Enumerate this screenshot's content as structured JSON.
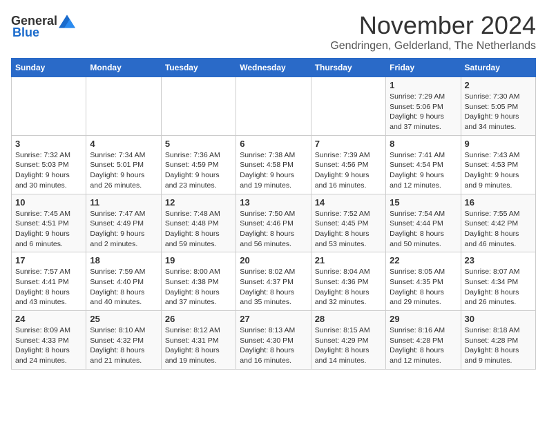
{
  "header": {
    "logo_general": "General",
    "logo_blue": "Blue",
    "title": "November 2024",
    "subtitle": "Gendringen, Gelderland, The Netherlands"
  },
  "days_of_week": [
    "Sunday",
    "Monday",
    "Tuesday",
    "Wednesday",
    "Thursday",
    "Friday",
    "Saturday"
  ],
  "weeks": [
    {
      "row_class": "row-1",
      "days": [
        {
          "number": "",
          "info": ""
        },
        {
          "number": "",
          "info": ""
        },
        {
          "number": "",
          "info": ""
        },
        {
          "number": "",
          "info": ""
        },
        {
          "number": "",
          "info": ""
        },
        {
          "number": "1",
          "info": "Sunrise: 7:29 AM\nSunset: 5:06 PM\nDaylight: 9 hours and 37 minutes."
        },
        {
          "number": "2",
          "info": "Sunrise: 7:30 AM\nSunset: 5:05 PM\nDaylight: 9 hours and 34 minutes."
        }
      ]
    },
    {
      "row_class": "row-2",
      "days": [
        {
          "number": "3",
          "info": "Sunrise: 7:32 AM\nSunset: 5:03 PM\nDaylight: 9 hours and 30 minutes."
        },
        {
          "number": "4",
          "info": "Sunrise: 7:34 AM\nSunset: 5:01 PM\nDaylight: 9 hours and 26 minutes."
        },
        {
          "number": "5",
          "info": "Sunrise: 7:36 AM\nSunset: 4:59 PM\nDaylight: 9 hours and 23 minutes."
        },
        {
          "number": "6",
          "info": "Sunrise: 7:38 AM\nSunset: 4:58 PM\nDaylight: 9 hours and 19 minutes."
        },
        {
          "number": "7",
          "info": "Sunrise: 7:39 AM\nSunset: 4:56 PM\nDaylight: 9 hours and 16 minutes."
        },
        {
          "number": "8",
          "info": "Sunrise: 7:41 AM\nSunset: 4:54 PM\nDaylight: 9 hours and 12 minutes."
        },
        {
          "number": "9",
          "info": "Sunrise: 7:43 AM\nSunset: 4:53 PM\nDaylight: 9 hours and 9 minutes."
        }
      ]
    },
    {
      "row_class": "row-3",
      "days": [
        {
          "number": "10",
          "info": "Sunrise: 7:45 AM\nSunset: 4:51 PM\nDaylight: 9 hours and 6 minutes."
        },
        {
          "number": "11",
          "info": "Sunrise: 7:47 AM\nSunset: 4:49 PM\nDaylight: 9 hours and 2 minutes."
        },
        {
          "number": "12",
          "info": "Sunrise: 7:48 AM\nSunset: 4:48 PM\nDaylight: 8 hours and 59 minutes."
        },
        {
          "number": "13",
          "info": "Sunrise: 7:50 AM\nSunset: 4:46 PM\nDaylight: 8 hours and 56 minutes."
        },
        {
          "number": "14",
          "info": "Sunrise: 7:52 AM\nSunset: 4:45 PM\nDaylight: 8 hours and 53 minutes."
        },
        {
          "number": "15",
          "info": "Sunrise: 7:54 AM\nSunset: 4:44 PM\nDaylight: 8 hours and 50 minutes."
        },
        {
          "number": "16",
          "info": "Sunrise: 7:55 AM\nSunset: 4:42 PM\nDaylight: 8 hours and 46 minutes."
        }
      ]
    },
    {
      "row_class": "row-4",
      "days": [
        {
          "number": "17",
          "info": "Sunrise: 7:57 AM\nSunset: 4:41 PM\nDaylight: 8 hours and 43 minutes."
        },
        {
          "number": "18",
          "info": "Sunrise: 7:59 AM\nSunset: 4:40 PM\nDaylight: 8 hours and 40 minutes."
        },
        {
          "number": "19",
          "info": "Sunrise: 8:00 AM\nSunset: 4:38 PM\nDaylight: 8 hours and 37 minutes."
        },
        {
          "number": "20",
          "info": "Sunrise: 8:02 AM\nSunset: 4:37 PM\nDaylight: 8 hours and 35 minutes."
        },
        {
          "number": "21",
          "info": "Sunrise: 8:04 AM\nSunset: 4:36 PM\nDaylight: 8 hours and 32 minutes."
        },
        {
          "number": "22",
          "info": "Sunrise: 8:05 AM\nSunset: 4:35 PM\nDaylight: 8 hours and 29 minutes."
        },
        {
          "number": "23",
          "info": "Sunrise: 8:07 AM\nSunset: 4:34 PM\nDaylight: 8 hours and 26 minutes."
        }
      ]
    },
    {
      "row_class": "row-5",
      "days": [
        {
          "number": "24",
          "info": "Sunrise: 8:09 AM\nSunset: 4:33 PM\nDaylight: 8 hours and 24 minutes."
        },
        {
          "number": "25",
          "info": "Sunrise: 8:10 AM\nSunset: 4:32 PM\nDaylight: 8 hours and 21 minutes."
        },
        {
          "number": "26",
          "info": "Sunrise: 8:12 AM\nSunset: 4:31 PM\nDaylight: 8 hours and 19 minutes."
        },
        {
          "number": "27",
          "info": "Sunrise: 8:13 AM\nSunset: 4:30 PM\nDaylight: 8 hours and 16 minutes."
        },
        {
          "number": "28",
          "info": "Sunrise: 8:15 AM\nSunset: 4:29 PM\nDaylight: 8 hours and 14 minutes."
        },
        {
          "number": "29",
          "info": "Sunrise: 8:16 AM\nSunset: 4:28 PM\nDaylight: 8 hours and 12 minutes."
        },
        {
          "number": "30",
          "info": "Sunrise: 8:18 AM\nSunset: 4:28 PM\nDaylight: 8 hours and 9 minutes."
        }
      ]
    }
  ]
}
